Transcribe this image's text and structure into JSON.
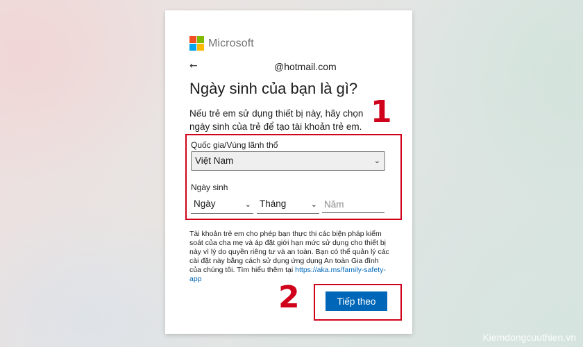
{
  "brand": {
    "name": "Microsoft",
    "colors": [
      "#f25022",
      "#7fba00",
      "#00a4ef",
      "#ffb900"
    ]
  },
  "identity": {
    "back_icon": "back-arrow-icon",
    "back_glyph": "←",
    "email": "@hotmail.com"
  },
  "title": "Ngày sinh của bạn là gì?",
  "description": "Nếu trẻ em sử dụng thiết bị này, hãy chọn ngày sinh của trẻ để tạo tài khoản trẻ em.",
  "form": {
    "country_label": "Quốc gia/Vùng lãnh thổ",
    "country_value": "Việt Nam",
    "birthdate_label": "Ngày sinh",
    "day_value": "Ngày",
    "month_value": "Tháng",
    "year_placeholder": "Năm"
  },
  "fine_print": "Tài khoản trẻ em cho phép bạn thực thi các biện pháp kiểm soát của cha mẹ và áp đặt giới hạn mức sử dụng cho thiết bị này vì lý do quyền riêng tư và an toàn. Bạn có thể quản lý các cài đặt này bằng cách sử dụng ứng dụng An toàn Gia đình của chúng tôi. Tìm hiểu thêm tại",
  "fine_print_link": "https://aka.ms/family-safety-app",
  "next_button": "Tiếp theo",
  "annotations": {
    "marker_1": "1",
    "marker_2": "2",
    "color": "#d0021b"
  },
  "watermark": "Kiemdongcuuthien.vn"
}
